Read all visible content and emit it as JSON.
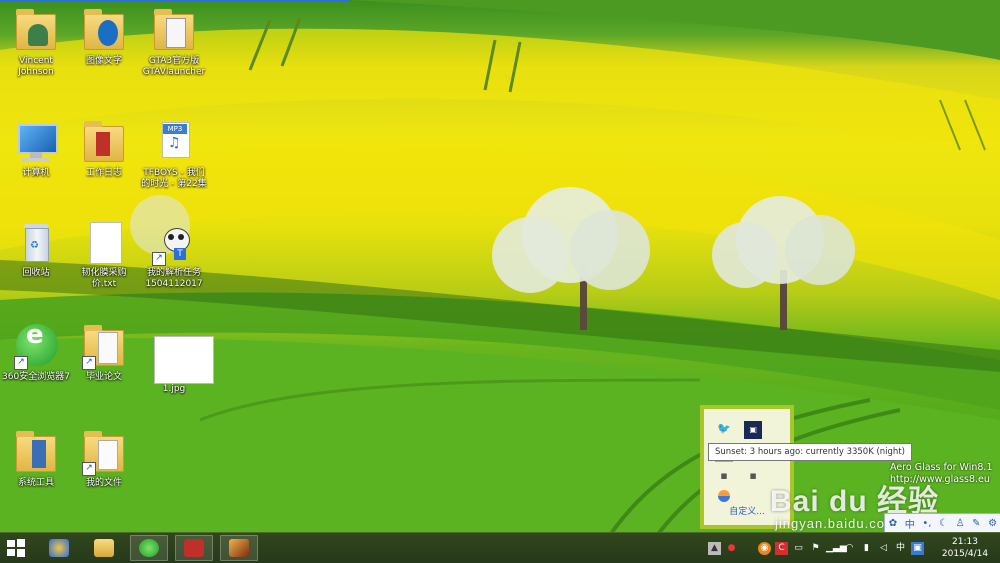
{
  "desktop": {
    "icons": [
      {
        "label": "Vincent Johnson"
      },
      {
        "label": "图像文字"
      },
      {
        "label": "GTA3官方版 GTAVlauncher"
      },
      {
        "label": "计算机"
      },
      {
        "label": "工作日志"
      },
      {
        "label": "TFBOYS - 我们的时光 - 第22集"
      },
      {
        "label": "回收站"
      },
      {
        "label": "韧化膜采购价.txt"
      },
      {
        "label": "我的解析任务 1504112017"
      },
      {
        "label": "360安全浏览器7"
      },
      {
        "label": "毕业论文"
      },
      {
        "label": "1.jpg"
      },
      {
        "label": "系统工具"
      },
      {
        "label": "我的文件"
      }
    ]
  },
  "tray_popup": {
    "tooltip": "Sunset: 3 hours ago: currently 3350K (night)",
    "customize_label": "自定义..."
  },
  "aero": {
    "line1": "Aero Glass for Win8.1",
    "line2": "http://www.glass8.eu"
  },
  "watermark": {
    "brand": "Bai du 经验",
    "url": "jingyan.baidu.com"
  },
  "ime": {
    "mode": "中"
  },
  "taskbar": {
    "ime_indicator": "中",
    "time": "21:13",
    "date": "2015/4/14"
  },
  "colors": {
    "taskbar_bg": "#2b3f1b",
    "popup_border": "#a9c52a",
    "accent_blue": "#2a6fdc"
  }
}
